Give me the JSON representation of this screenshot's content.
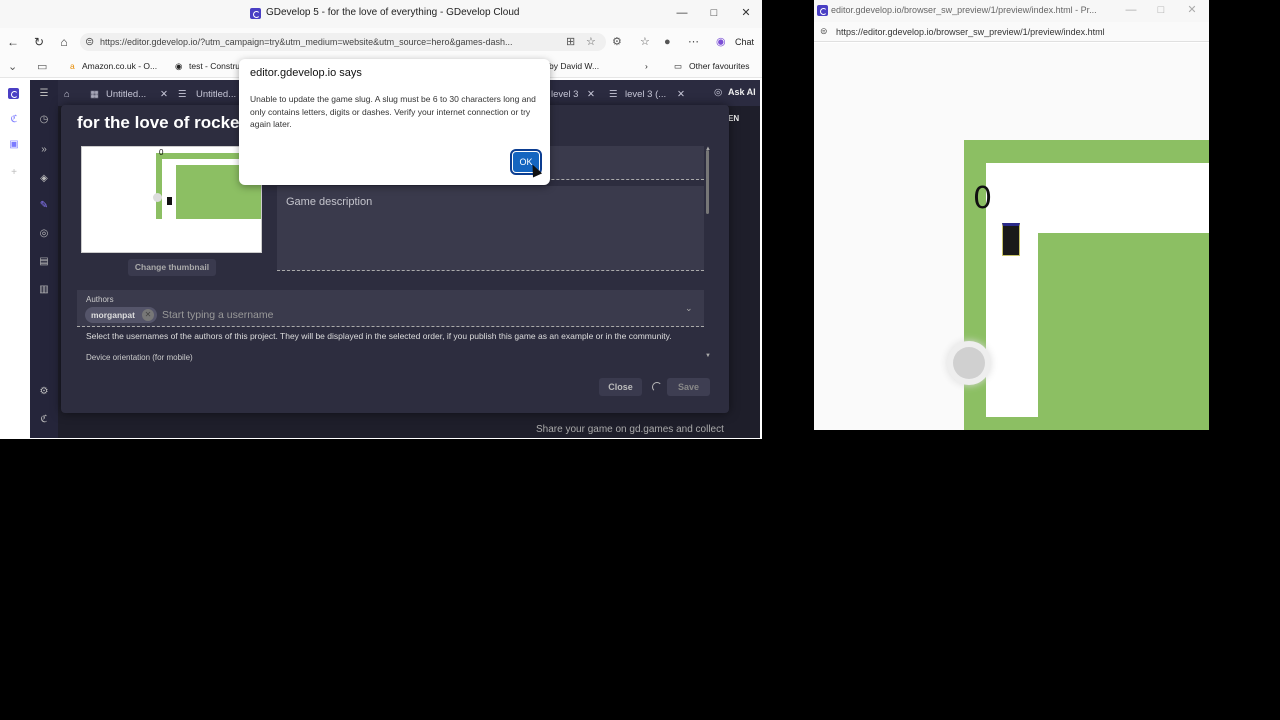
{
  "left_window": {
    "title": "GDevelop 5 - for the love of everything - GDevelop Cloud",
    "url": "https://editor.gdevelop.io/?utm_campaign=try&utm_medium=website&utm_source=hero&games-dash...",
    "chat_label": "Chat",
    "bookmarks": [
      "Amazon.co.uk - O...",
      "test - Constru...",
      "by David W...",
      "Other favourites"
    ],
    "tabs": [
      "Untitled...",
      "Untitled...",
      "level 3",
      "level 3 (..."
    ],
    "ask_ai": "Ask AI",
    "language": "EN",
    "share_text": "Share your game on gd.games and collect"
  },
  "dialog": {
    "game_title": "for the love of rocket",
    "change_thumbnail": "Change thumbnail",
    "description_placeholder": "Game description",
    "authors_label": "Authors",
    "author_chip": "morganpat",
    "author_input_placeholder": "Start typing a username",
    "authors_help": "Select the usernames of the authors of this project. They will be displayed in the selected order, if you publish this game as an example or in the community.",
    "orientation_label": "Device orientation (for mobile)",
    "close_label": "Close",
    "save_label": "Save",
    "thumbnail_score": "0"
  },
  "alert": {
    "title": "editor.gdevelop.io says",
    "message": "Unable to update the game slug. A slug must be 6 to 30 characters long and only contains letters, digits or dashes. Verify your internet connection or try again later.",
    "ok_label": "OK"
  },
  "right_window": {
    "title": "editor.gdevelop.io/browser_sw_preview/1/preview/index.html - Pr...",
    "url": "https://editor.gdevelop.io/browser_sw_preview/1/preview/index.html",
    "score": "0"
  },
  "colors": {
    "editor_bg": "#1e1e2a",
    "dialog_bg": "#2d2d3f",
    "game_green": "#8cbf63",
    "ok_blue": "#1565c0"
  }
}
